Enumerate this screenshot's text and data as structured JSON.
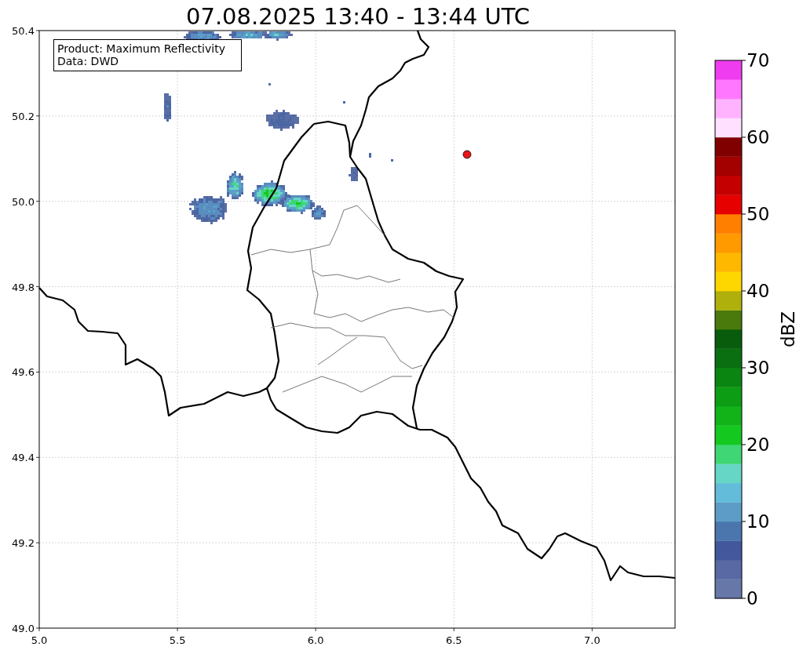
{
  "title": "07.08.2025 13:40 - 13:44 UTC",
  "map": {
    "info_box": [
      "Product: Maximum Reflectivity",
      "Data: DWD"
    ],
    "x_ticks": [
      "5.0",
      "5.5",
      "6.0",
      "6.5",
      "7.0"
    ],
    "y_ticks": [
      "50.4",
      "50.2",
      "50.0",
      "49.8",
      "49.6",
      "49.4",
      "49.2",
      "49.0"
    ]
  },
  "colorbar": {
    "label": "dBZ",
    "ticks": [
      "70",
      "60",
      "50",
      "40",
      "30",
      "20",
      "10",
      "0"
    ],
    "segments": [
      {
        "color": "#6677a8"
      },
      {
        "color": "#5869a3"
      },
      {
        "color": "#43579c"
      },
      {
        "color": "#4a76ad"
      },
      {
        "color": "#5d9cc6"
      },
      {
        "color": "#63bcd9"
      },
      {
        "color": "#66d6c6"
      },
      {
        "color": "#3fd675"
      },
      {
        "color": "#15c820"
      },
      {
        "color": "#11b318"
      },
      {
        "color": "#0d9d14"
      },
      {
        "color": "#0b8512"
      },
      {
        "color": "#0a6f11"
      },
      {
        "color": "#085c0c"
      },
      {
        "color": "#497a0b"
      },
      {
        "color": "#b0b00c"
      },
      {
        "color": "#ffd700"
      },
      {
        "color": "#ffb800"
      },
      {
        "color": "#ff9a00"
      },
      {
        "color": "#ff7f00"
      },
      {
        "color": "#e60000"
      },
      {
        "color": "#c40000"
      },
      {
        "color": "#a30000"
      },
      {
        "color": "#800000"
      },
      {
        "color": "#ffe0ff"
      },
      {
        "color": "#ffb3ff"
      },
      {
        "color": "#ff77ff"
      },
      {
        "color": "#f03cf0"
      }
    ]
  }
}
